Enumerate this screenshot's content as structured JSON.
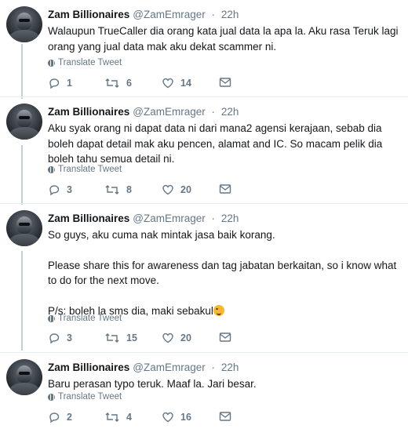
{
  "tweets": [
    {
      "name": "Zam Billionaires",
      "handle": "@ZamEmrager",
      "dot": "·",
      "time": "22h",
      "text": "Walaupun TrueCaller dia orang kata jual data la apa la. Aku rasa Teruk lagi orang yang jual data mak aku dekat scammer ni.",
      "translate": "Translate Tweet",
      "replies": "1",
      "retweets": "6",
      "likes": "14"
    },
    {
      "name": "Zam Billionaires",
      "handle": "@ZamEmrager",
      "dot": "·",
      "time": "22h",
      "text": "Aku syak orang ni dapat data ni dari mana2 agensi kerajaan, sebab dia boleh dapat detail mak aku pencen, alamat and IC. So macam pelik dia boleh tahu semua detail ni.",
      "translate": "Translate Tweet",
      "replies": "3",
      "retweets": "8",
      "likes": "20"
    },
    {
      "name": "Zam Billionaires",
      "handle": "@ZamEmrager",
      "dot": "·",
      "time": "22h",
      "text_line1": "So guys, aku cuma nak mintak jasa baik korang.",
      "text_line2": "Please share this for awareness dan tag jabatan berkaitan, so i know what to do for the next move.",
      "text_line3": "P/s: boleh la sms dia, maki sebakul",
      "translate": "Translate Tweet",
      "replies": "3",
      "retweets": "15",
      "likes": "20"
    },
    {
      "name": "Zam Billionaires",
      "handle": "@ZamEmrager",
      "dot": "·",
      "time": "22h",
      "text": "Baru perasan typo teruk. Maaf la. Jari besar.",
      "translate": "Translate Tweet",
      "replies": "2",
      "retweets": "4",
      "likes": "16"
    }
  ],
  "icons": {
    "reply": "reply-icon",
    "retweet": "retweet-icon",
    "like": "heart-icon",
    "dm": "envelope-icon",
    "translate": "globe-icon",
    "emoji": "winking-face-emoji"
  },
  "colors": {
    "text": "#14171a",
    "secondary": "#657786",
    "divider": "#e6ecf0",
    "thread_line": "#c4cfd6"
  }
}
